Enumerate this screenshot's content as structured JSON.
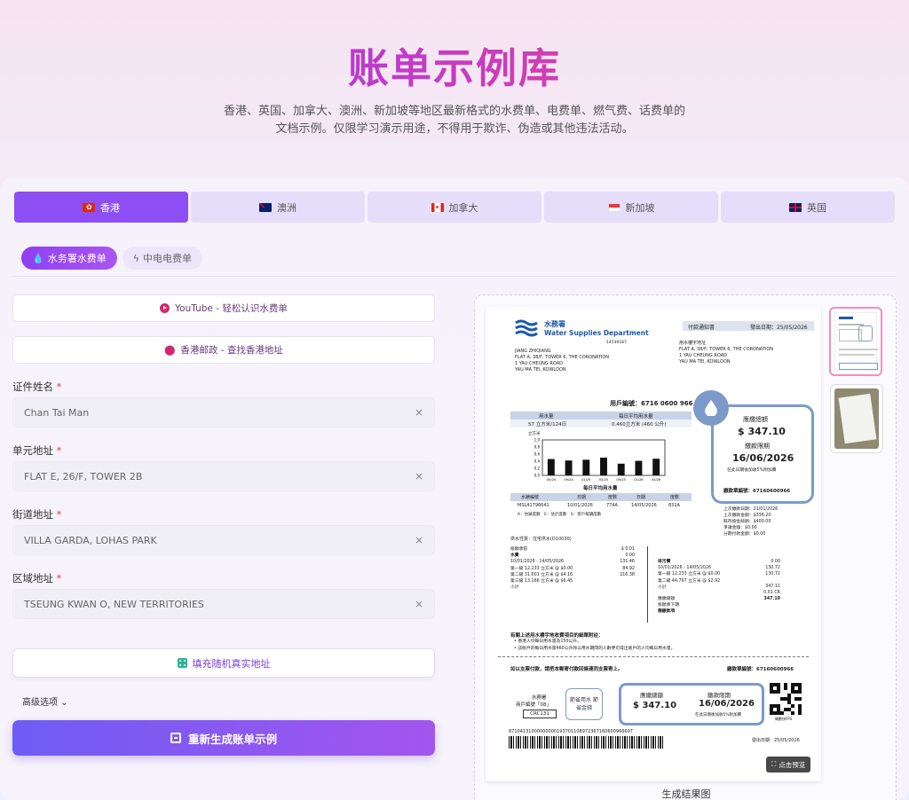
{
  "header": {
    "title": "账单示例库",
    "subtitle": "香港、英国、加拿大、澳洲、新加坡等地区最新格式的水费单、电费单、燃气费、话费单的文档示例。仅限学习演示用途，不得用于欺诈、伪造或其他违法活动。"
  },
  "tabs": [
    {
      "label": "香港",
      "flag": "hk"
    },
    {
      "label": "澳洲",
      "flag": "au"
    },
    {
      "label": "加拿大",
      "flag": "ca"
    },
    {
      "label": "新加坡",
      "flag": "sg"
    },
    {
      "label": "英国",
      "flag": "gb"
    }
  ],
  "subtabs": [
    {
      "label": "水务署水费单"
    },
    {
      "label": "中电电费单"
    }
  ],
  "links": {
    "youtube": "YouTube - 轻松认识水费单",
    "post": "香港邮政 - 查找香港地址"
  },
  "form": {
    "name_label": "证件姓名",
    "name_value": "Chan Tai Man",
    "unit_label": "单元地址",
    "unit_value": "FLAT E, 26/F, TOWER 2B",
    "street_label": "街道地址",
    "street_value": "VILLA GARDA, LOHAS PARK",
    "region_label": "区域地址",
    "region_value": "TSEUNG KWAN O, NEW TERRITORIES",
    "required_mark": "*",
    "clear_glyph": "×"
  },
  "fill_button": "填充随机真实地址",
  "advanced": "高级选项",
  "generate_button": "重新生成账单示例",
  "preview": {
    "caption": "生成结果图",
    "zoom": "点击预览"
  },
  "bill": {
    "dept_cn": "水務署",
    "dept_en": "Water Supplies Department",
    "code": "14539187",
    "mail_name": "JIANG ZHIQIANG",
    "mail_addr1": "FLAT A, 38/F, TOWER 6, THE CORONATION",
    "mail_addr2": "1 YAU CHEUNG ROAD",
    "mail_addr3": "YAU MA TEI, KOWLOON",
    "notice": "付款通知書",
    "issue_date": "發出日期：25/05/2026",
    "supply_label": "用水樓宇地址",
    "supply_addr1": "FLAT A, 38/F, TOWER 6, THE CORONATION",
    "supply_addr2": "1 YAU CHEUNG ROAD",
    "supply_addr3": "YAU MA TEI, KOWLOON",
    "account": "用戶編號：6716 0600 966",
    "usage_h1": "用水量",
    "usage_h2": "每日平均用水量",
    "usage_v1": "57 立方米/124日",
    "usage_v2": "0.460立方米 (460 公升)",
    "chart_unit": "立方米",
    "chart_title": "每日平均用水量",
    "yticks": [
      "1.0",
      "0.8",
      "0.6",
      "0.4",
      "0.2",
      "0.0"
    ],
    "xticks": [
      "05/24",
      "09/24",
      "01/25",
      "05/25",
      "09/25",
      "01/26",
      "05/26"
    ],
    "bar_values": [
      0.46,
      0.42,
      0.44,
      0.5,
      0.33,
      0.41,
      0.47
    ],
    "meter_h": [
      "水錶編號",
      "日期",
      "度數",
      "日期",
      "度數"
    ],
    "meter_v": [
      "MSL41796641",
      "10/01/2026",
      "774A",
      "14/05/2026",
      "831A"
    ],
    "meter_note": "A：仿錶度數　E：估計度數　S：客戶報讀度數",
    "total_label": "應繳總額",
    "total": "$ 347.10",
    "due_label": "繳款限期",
    "due": "16/06/2026",
    "late": "在此日期後加收5%附加費",
    "acct_small": "繳款單編號：67160600966",
    "summary": [
      "上次繳款日期：21/01/2026",
      "上次繳款金額：$336.20",
      "既存按金餘額：$400.00",
      "爭議金額：$0.00",
      "分期付款金額：$0.00"
    ],
    "supply_type": "供水性質：住宅供水(D10030)",
    "water_lines": [
      "賬額承前",
      "水費",
      "10/01/2026 - 14/05/2026",
      "第一級 12.233 立方米 @ $0.00",
      "第二級 31.601 立方米 @ $4.16",
      "第三級 13.166 立方米 @ $6.45",
      "小計"
    ],
    "water_vals": [
      "$ 0.01",
      "",
      "",
      "0.00",
      "131.46",
      "84.92",
      "216.38"
    ],
    "sewage_lines": [
      "排污費",
      "10/01/2026 - 14/05/2026",
      "第一級 12.233 立方米 @ $0.00",
      "第二級 44.767 立方米 @ $2.92",
      "小計",
      "應繳總額",
      "賬額承下期",
      "應繳款項"
    ],
    "sewage_vals": [
      "",
      "",
      "0.00",
      "130.72",
      "130.72",
      "347.11",
      "0.01 CR",
      "347.10"
    ],
    "notes_title": "有關上述用水樓宇地收費項目的細單附註：",
    "notes": [
      "香港人均每日用水量為150公升。",
      "該賬戶的每日用水量460公升除以用水期間的人數便可得出賬戶的人均每日用水量。"
    ],
    "slip_title": "如以支票付款，請把本郵寄付款回條連同支票寄上。",
    "slip_acct": "繳款單編號：67160600966",
    "slip_dept": "水務署",
    "slip_code_lbl": "商戶編號「08」",
    "slip_code": "CRC131",
    "slip_save": "節省用水 節省金錢",
    "slip_total_lbl": "應繳總額",
    "slip_total": "$ 347.10",
    "slip_due_lbl": "繳款限期",
    "slip_due": "16/06/2026",
    "slip_late": "在此日期後加收5%附加費",
    "qr_label": "轉數快FPS",
    "barcode_num": "87104131000000000193701108972367160600966697",
    "issue2": "發出日期　25/05/2026"
  },
  "colors": {
    "accent": "#8d4ff4",
    "bill_blue": "#7b9ac9"
  }
}
